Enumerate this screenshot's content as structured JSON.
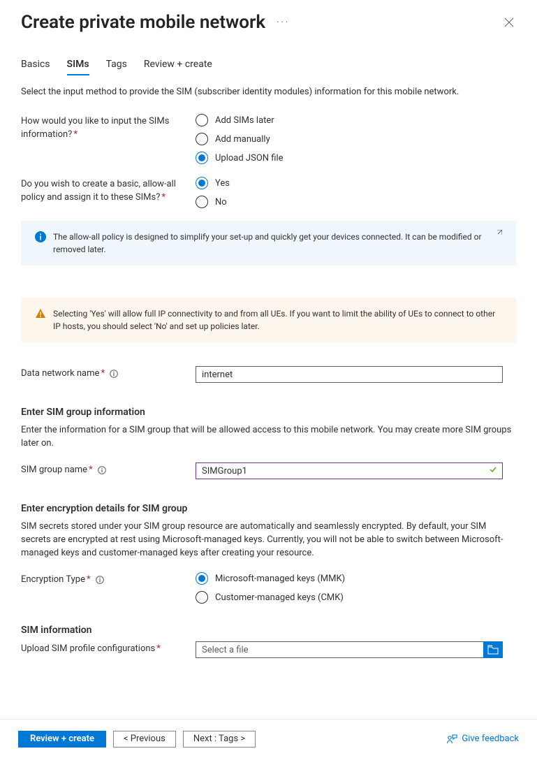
{
  "header": {
    "title": "Create private mobile network"
  },
  "tabs": [
    "Basics",
    "SIMs",
    "Tags",
    "Review + create"
  ],
  "active_tab_index": 1,
  "intro": "Select the input method to provide the SIM (subscriber identity modules) information for this mobile network.",
  "sim_input": {
    "label": "How would you like to input the SIMs information?",
    "options": [
      "Add SIMs later",
      "Add manually",
      "Upload JSON file"
    ],
    "selected_index": 2
  },
  "allow_all": {
    "label": "Do you wish to create a basic, allow-all policy and assign it to these SIMs?",
    "options": [
      "Yes",
      "No"
    ],
    "selected_index": 0
  },
  "info_callout": "The allow-all policy is designed to simplify your set-up and quickly get your devices connected. It can be modified or removed later.",
  "warn_callout": "Selecting 'Yes' will allow full IP connectivity to and from all UEs. If you want to limit the ability of UEs to connect to other IP hosts, you should select 'No' and set up policies later.",
  "data_network": {
    "label": "Data network name",
    "value": "internet"
  },
  "sim_group_section": {
    "title": "Enter SIM group information",
    "desc": "Enter the information for a SIM group that will be allowed access to this mobile network. You may create more SIM groups later on.",
    "name_label": "SIM group name",
    "name_value": "SIMGroup1"
  },
  "encryption_section": {
    "title": "Enter encryption details for SIM group",
    "desc": "SIM secrets stored under your SIM group resource are automatically and seamlessly encrypted. By default, your SIM secrets are encrypted at rest using Microsoft-managed keys. Currently, you will not be able to switch between Microsoft-managed keys and customer-managed keys after creating your resource.",
    "type_label": "Encryption Type",
    "options": [
      "Microsoft-managed keys (MMK)",
      "Customer-managed keys (CMK)"
    ],
    "selected_index": 0
  },
  "sim_info_section": {
    "title": "SIM information",
    "upload_label": "Upload SIM profile configurations",
    "placeholder": "Select a file"
  },
  "footer": {
    "review": "Review + create",
    "previous": "< Previous",
    "next": "Next : Tags >",
    "feedback": "Give feedback"
  }
}
